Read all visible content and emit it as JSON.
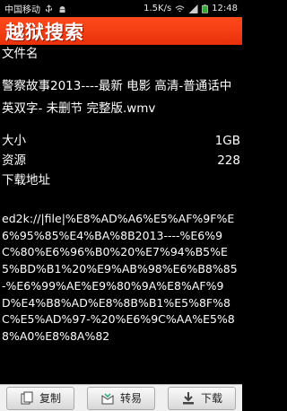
{
  "status": {
    "carrier": "中国移动",
    "speed": "1.5K/s",
    "time": "12:48"
  },
  "header": {
    "title": "越狱搜索"
  },
  "detail": {
    "filename_label": "文件名",
    "filename": "警察故事2013----最新 电影 高清-普通话中英双字- 未删节 完整版.wmv",
    "size_label": "大小",
    "size_value": "1GB",
    "sources_label": "资源",
    "sources_value": "228",
    "download_label": "下载地址",
    "link": "ed2k://|file|%E8%AD%A6%E5%AF%9F%E6%95%85%E4%BA%8B2013----%E6%9C%80%E6%96%B0%20%E7%94%B5%E5%BD%B1%20%E9%AB%98%E6%B8%85-%E6%99%AE%E9%80%9A%E8%AF%9D%E4%B8%AD%E8%8B%B1%E5%8F%8C%E5%AD%97-%20%E6%9C%AA%E5%88%A0%E8%8A%82"
  },
  "toolbar": {
    "copy_label": "复制",
    "share_label": "转易",
    "download_label": "下载"
  },
  "icons": {
    "usb": "usb-icon",
    "android": "android-icon",
    "wifi": "wifi-icon",
    "signal": "signal-icon",
    "battery": "battery-icon"
  },
  "colors": {
    "title_bar": "#e8310a",
    "background": "#000000",
    "bottom_bar": "#f0f0f0"
  }
}
